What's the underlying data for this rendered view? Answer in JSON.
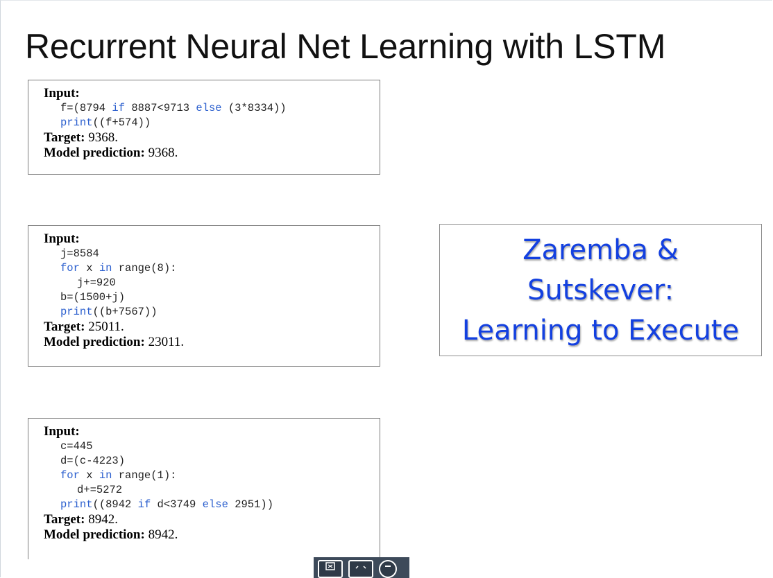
{
  "slide": {
    "title": "Recurrent Neural Net Learning with LSTM"
  },
  "examples": [
    {
      "input_label": "Input:",
      "code": [
        {
          "indent": 1,
          "parts": [
            {
              "t": "f=(8794 "
            },
            {
              "t": "if",
              "kw": true
            },
            {
              "t": " 8887<9713 "
            },
            {
              "t": "else",
              "kw": true
            },
            {
              "t": " (3*8334))"
            }
          ]
        },
        {
          "indent": 1,
          "parts": [
            {
              "t": "print",
              "kw": true
            },
            {
              "t": "((f+574))"
            }
          ]
        }
      ],
      "target_label": "Target:",
      "target_value": " 9368.",
      "prediction_label": "Model prediction:",
      "prediction_value": " 9368."
    },
    {
      "input_label": "Input:",
      "code": [
        {
          "indent": 1,
          "parts": [
            {
              "t": "j=8584"
            }
          ]
        },
        {
          "indent": 1,
          "parts": [
            {
              "t": "for",
              "kw": true
            },
            {
              "t": " x "
            },
            {
              "t": "in",
              "kw": true
            },
            {
              "t": " range(8):"
            }
          ]
        },
        {
          "indent": 2,
          "parts": [
            {
              "t": "j+=920"
            }
          ]
        },
        {
          "indent": 1,
          "parts": [
            {
              "t": "b=(1500+j)"
            }
          ]
        },
        {
          "indent": 1,
          "parts": [
            {
              "t": "print",
              "kw": true
            },
            {
              "t": "((b+7567))"
            }
          ]
        }
      ],
      "target_label": "Target:",
      "target_value": " 25011.",
      "prediction_label": "Model prediction:",
      "prediction_value": " 23011."
    },
    {
      "input_label": "Input:",
      "code": [
        {
          "indent": 1,
          "parts": [
            {
              "t": "c=445"
            }
          ]
        },
        {
          "indent": 1,
          "parts": [
            {
              "t": "d=(c-4223)"
            }
          ]
        },
        {
          "indent": 1,
          "parts": [
            {
              "t": "for",
              "kw": true
            },
            {
              "t": " x "
            },
            {
              "t": "in",
              "kw": true
            },
            {
              "t": " range(1):"
            }
          ]
        },
        {
          "indent": 2,
          "parts": [
            {
              "t": "d+=5272"
            }
          ]
        },
        {
          "indent": 1,
          "parts": [
            {
              "t": "print",
              "kw": true
            },
            {
              "t": "((8942 "
            },
            {
              "t": "if",
              "kw": true
            },
            {
              "t": " d<3749 "
            },
            {
              "t": "else",
              "kw": true
            },
            {
              "t": " 2951))"
            }
          ]
        }
      ],
      "target_label": "Target:",
      "target_value": " 8942.",
      "prediction_label": "Model prediction:",
      "prediction_value": " 8942."
    }
  ],
  "citation": {
    "lines": [
      "Zaremba &",
      "Sutskever:",
      "Learning to Execute"
    ],
    "color": "#1340e0"
  },
  "toolbar": {
    "buttons": [
      {
        "icon": "fit-screen-icon"
      },
      {
        "icon": "fullscreen-icon"
      },
      {
        "icon": "zoom-out-icon"
      }
    ]
  },
  "colors": {
    "keyword": "#2b5fce",
    "toolbar_bg": "#3d4a5a"
  }
}
